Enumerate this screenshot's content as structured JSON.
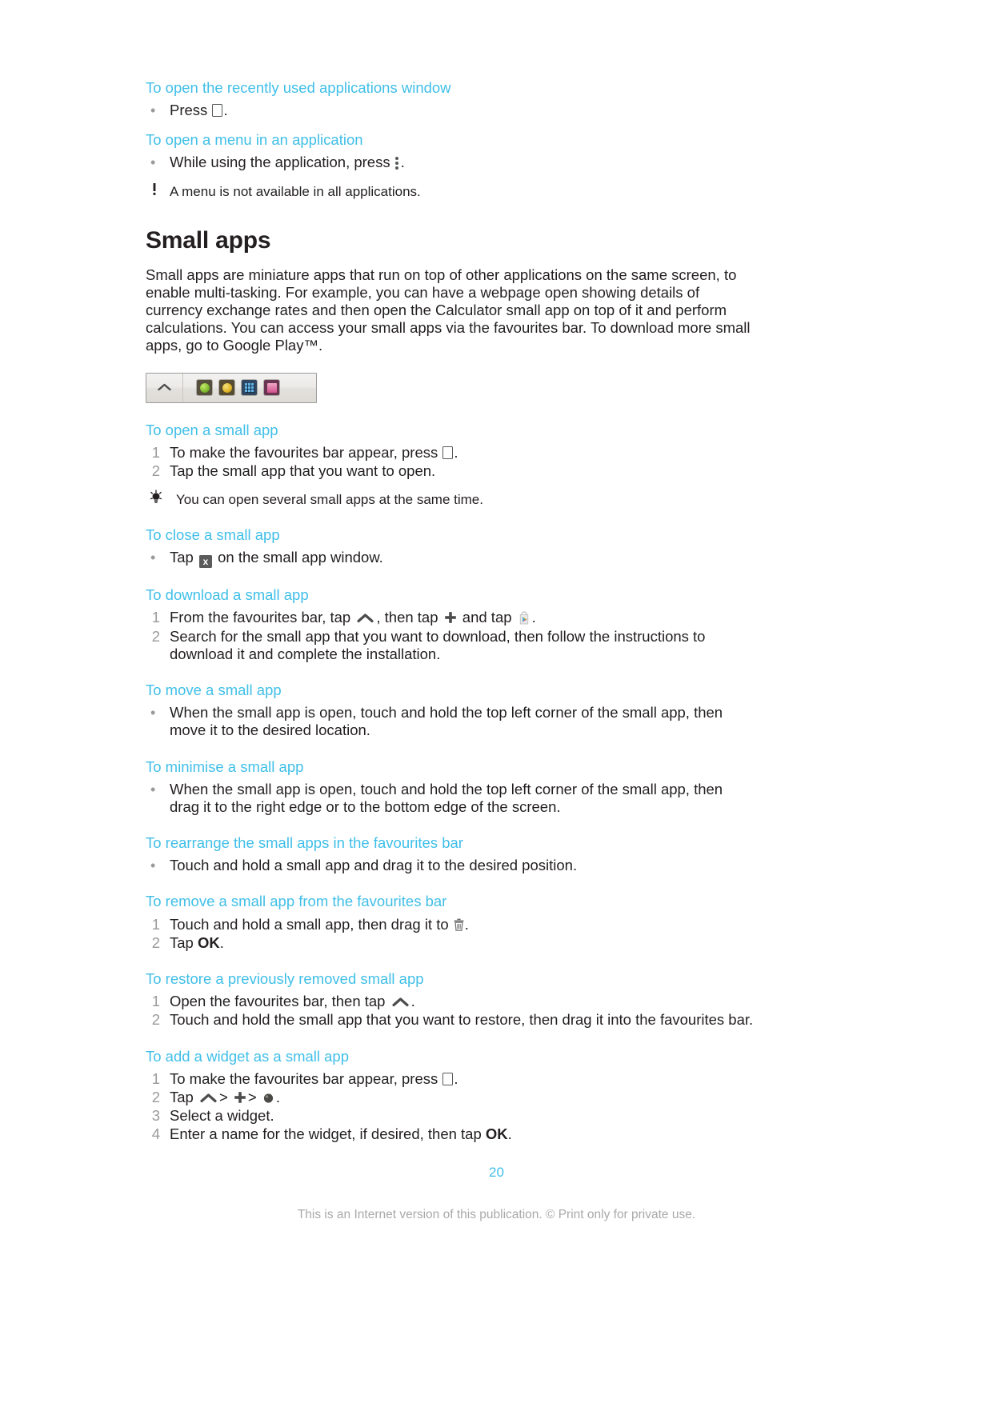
{
  "document": {
    "page_number": "20",
    "footer_note": "This is an Internet version of this publication. © Print only for private use.",
    "accent_color": "#40bfe8",
    "text_color": "#231f20",
    "muted_color": "#9a9a9a"
  },
  "sections": {
    "recent_apps": {
      "title": "To open the recently used applications window",
      "step1_pre": "Press",
      "step1_post": "."
    },
    "open_menu": {
      "title": "To open a menu in an application",
      "step1_pre": "While using the application, press",
      "step1_post": ".",
      "note": "A menu is not available in all applications."
    },
    "small_apps": {
      "heading": "Small apps",
      "intro": "Small apps are miniature apps that run on top of other applications on the same screen, to enable multi-tasking. For example, you can have a webpage open showing details of currency exchange rates and then open the Calculator small app on top of it and perform calculations. You can access your small apps via the favourites bar. To download more small apps, go to Google Play™."
    },
    "favourites_bar_image": {
      "expander_icon": "chevron-up-icon",
      "apps": [
        {
          "name": "app-icon-green",
          "bg": "#5d5a4e",
          "color": "#8cc63f"
        },
        {
          "name": "app-icon-yellow",
          "bg": "#5a5340",
          "color": "#e8c03a"
        },
        {
          "name": "app-icon-calculator",
          "bg": "#3a4a5c",
          "color": "#7fc4e8"
        },
        {
          "name": "app-icon-pink",
          "bg": "#6b4050",
          "color": "#e06a9c"
        }
      ]
    },
    "open_small_app": {
      "title": "To open a small app",
      "step1_pre": "To make the favourites bar appear, press",
      "step1_post": ".",
      "step2": "Tap the small app that you want to open.",
      "tip": "You can open several small apps at the same time."
    },
    "close_small_app": {
      "title": "To close a small app",
      "step1_pre": "Tap",
      "step1_post": "on the small app window."
    },
    "download_small_app": {
      "title": "To download a small app",
      "step1_a": "From the favourites bar, tap",
      "step1_b": ", then tap",
      "step1_c": "and tap",
      "step1_d": ".",
      "step2": "Search for the small app that you want to download, then follow the instructions to download it and complete the installation."
    },
    "move_small_app": {
      "title": "To move a small app",
      "step1": "When the small app is open, touch and hold the top left corner of the small app, then move it to the desired location."
    },
    "minimise_small_app": {
      "title": "To minimise a small app",
      "step1": "When the small app is open, touch and hold the top left corner of the small app, then drag it to the right edge or to the bottom edge of the screen."
    },
    "rearrange_small_apps": {
      "title": "To rearrange the small apps in the favourites bar",
      "step1": "Touch and hold a small app and drag it to the desired position."
    },
    "remove_small_app": {
      "title": "To remove a small app from the favourites bar",
      "step1_pre": "Touch and hold a small app, then drag it to",
      "step1_post": ".",
      "step2_pre": "Tap",
      "step2_bold": "OK",
      "step2_post": "."
    },
    "restore_small_app": {
      "title": "To restore a previously removed small app",
      "step1_pre": "Open the favourites bar, then tap",
      "step1_post": ".",
      "step2": "Touch and hold the small app that you want to restore, then drag it into the favourites bar."
    },
    "add_widget": {
      "title": "To add a widget as a small app",
      "step1_pre": "To make the favourites bar appear, press",
      "step1_post": ".",
      "step2_pre": "Tap",
      "step2_sep1": ">",
      "step2_sep2": ">",
      "step2_post": ".",
      "step3": "Select a widget.",
      "step4_pre": "Enter a name for the widget, if desired, then tap",
      "step4_bold": "OK",
      "step4_post": "."
    }
  }
}
